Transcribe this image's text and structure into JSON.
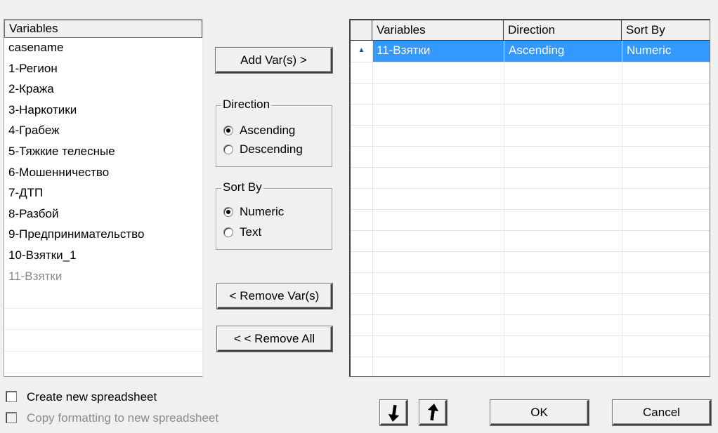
{
  "variables_list": {
    "header": "Variables",
    "items": [
      {
        "label": "casename"
      },
      {
        "label": "1-Регион"
      },
      {
        "label": "2-Кража"
      },
      {
        "label": "3-Наркотики"
      },
      {
        "label": "4-Грабеж"
      },
      {
        "label": "5-Тяжкие телесные"
      },
      {
        "label": "6-Мошенничество"
      },
      {
        "label": "7-ДТП"
      },
      {
        "label": "8-Разбой"
      },
      {
        "label": "9-Предпринимательство"
      },
      {
        "label": "10-Взятки_1"
      },
      {
        "label": "11-Взятки",
        "disabled": true
      }
    ]
  },
  "buttons": {
    "add_vars": "Add Var(s) >",
    "remove_vars": "< Remove Var(s)",
    "remove_all": "< < Remove All",
    "ok": "OK",
    "cancel": "Cancel"
  },
  "direction_group": {
    "title": "Direction",
    "options": [
      {
        "label": "Ascending",
        "checked": true
      },
      {
        "label": "Descending",
        "checked": false
      }
    ]
  },
  "sortby_group": {
    "title": "Sort By",
    "options": [
      {
        "label": "Numeric",
        "checked": true
      },
      {
        "label": "Text",
        "checked": false
      }
    ]
  },
  "sort_grid": {
    "headers": [
      "",
      "Variables",
      "Direction",
      "Sort By"
    ],
    "rows": [
      {
        "marker": "▲",
        "variable": "11-Взятки",
        "direction": "Ascending",
        "sort_by": "Numeric",
        "selected": true
      }
    ]
  },
  "options": {
    "create_new_spreadsheet": {
      "label": "Create new spreadsheet",
      "checked": false
    },
    "copy_formatting": {
      "label": "Copy formatting to new spreadsheet",
      "checked": false,
      "disabled": true
    }
  },
  "icons": {
    "move_down": "arrow-down-icon",
    "move_up": "arrow-up-icon"
  }
}
